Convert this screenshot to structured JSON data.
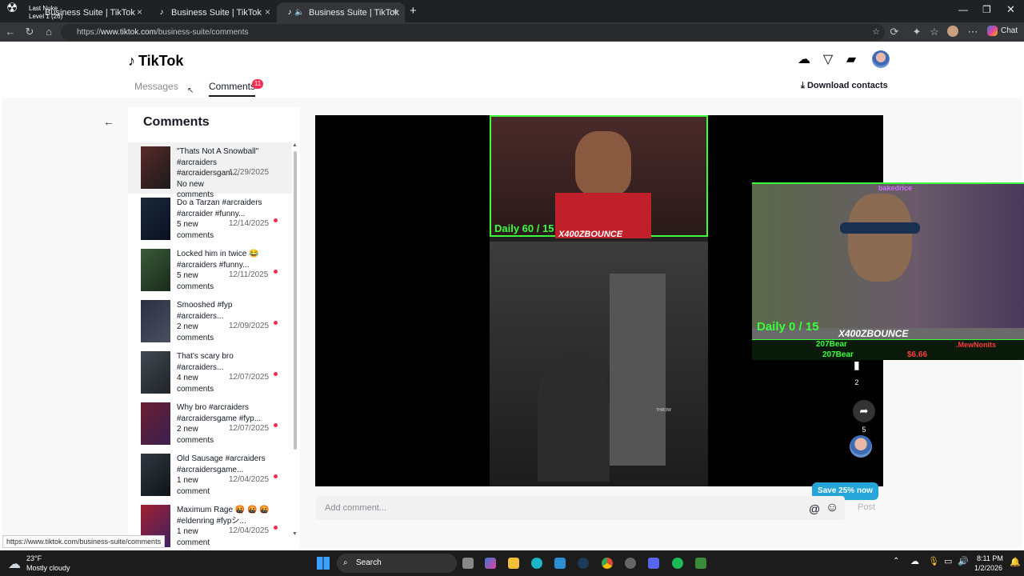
{
  "browser": {
    "tabs": [
      {
        "label": "Business Suite | TikTok",
        "close": "×"
      },
      {
        "label": "Business Suite | TikTok",
        "close": "×"
      },
      {
        "label": "Business Suite | TikTok",
        "close": "×"
      }
    ],
    "overlay": {
      "title": "Last Nuke",
      "subtitle": "Level 1 (26)"
    },
    "url_prefix": "https://",
    "url_host": "www.tiktok.com",
    "url_path": "/business-suite/comments",
    "chat_label": "Chat"
  },
  "header": {
    "logo": "TikTok",
    "tabs": {
      "messages": "Messages",
      "comments": "Comments"
    },
    "comments_badge": "11",
    "download": "Download contacts"
  },
  "list": {
    "title": "Comments",
    "items": [
      {
        "title": "\"Thats Not A Snowball\" #arcraiders #arcraidersgam...",
        "status1": "No new",
        "status2": "comments",
        "date": "12/29/2025",
        "unread": false
      },
      {
        "title": "Do a Tarzan #arcraiders #arcraider #funny...",
        "status1": "5 new",
        "status2": "comments",
        "date": "12/14/2025",
        "unread": true
      },
      {
        "title": "Locked him in twice 😂 #arcraiders #funny...",
        "status1": "5 new",
        "status2": "comments",
        "date": "12/11/2025",
        "unread": true
      },
      {
        "title": "Smooshed #fyp #arcraiders...",
        "status1": "2 new",
        "status2": "comments",
        "date": "12/09/2025",
        "unread": true
      },
      {
        "title": "That's scary bro #arcraiders...",
        "status1": "4 new",
        "status2": "comments",
        "date": "12/07/2025",
        "unread": true
      },
      {
        "title": "Why bro #arcraiders #arcraidersgame #fyp...",
        "status1": "2 new",
        "status2": "comments",
        "date": "12/07/2025",
        "unread": true
      },
      {
        "title": "Old Sausage #arcraiders #arcraidersgame...",
        "status1": "1 new",
        "status2": "comment",
        "date": "12/04/2025",
        "unread": true
      },
      {
        "title": "Maximum Rage 🤬 🤬 🤬 #eldenring #fypシ...",
        "status1": "1 new",
        "status2": "comment",
        "date": "12/04/2025",
        "unread": true
      }
    ]
  },
  "video": {
    "overlay_daily_top": "Daily 60 / 15",
    "overlay_name_top": "X400ZBOUNCE",
    "overlay_daily_cam": "Daily 0 / 15",
    "overlay_name_cam": "X400ZBOUNCE",
    "alert1": "207Bear",
    "alert2": "207Bear",
    "alert_amount": "$6.66",
    "alert_user": ".MewNonits",
    "cam_tag": "bakedrice",
    "hud_throw": "THROW",
    "save_count": "2",
    "share_count": "5"
  },
  "composer": {
    "placeholder": "Add comment...",
    "post": "Post",
    "at": "@",
    "emoji": "☺"
  },
  "promo": "Save 25% now",
  "status_url": "https://www.tiktok.com/business-suite/comments",
  "taskbar": {
    "temp": "23°F",
    "weather": "Mostly cloudy",
    "search": "Search",
    "time": "8:11 PM",
    "date": "1/2/2026"
  },
  "colors": {
    "accent": "#fe2c55",
    "promo": "#26a6d8",
    "neon": "#3cff3c"
  }
}
